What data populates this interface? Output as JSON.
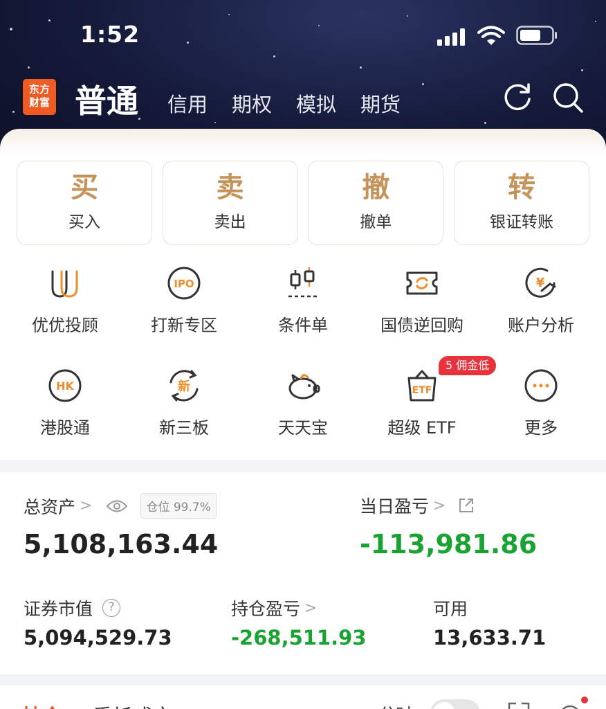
{
  "status": {
    "time": "1:52"
  },
  "header": {
    "logo_line1": "东方",
    "logo_line2": "财富",
    "active_mode": "普通",
    "modes": [
      "信用",
      "期权",
      "模拟",
      "期货"
    ]
  },
  "quick_actions": [
    {
      "big": "买",
      "label": "买入"
    },
    {
      "big": "卖",
      "label": "卖出"
    },
    {
      "big": "撤",
      "label": "撤单"
    },
    {
      "big": "转",
      "label": "银证转账"
    }
  ],
  "grid": [
    {
      "icon": "uu-icon",
      "label": "优优投顾"
    },
    {
      "icon": "ipo-icon",
      "icon_text": "IPO",
      "label": "打新专区"
    },
    {
      "icon": "candlestick-icon",
      "label": "条件单"
    },
    {
      "icon": "ticket-icon",
      "label": "国债逆回购"
    },
    {
      "icon": "yuan-chart-icon",
      "icon_text": "¥",
      "label": "账户分析"
    },
    {
      "icon": "hk-icon",
      "icon_text": "HK",
      "label": "港股通"
    },
    {
      "icon": "xin-icon",
      "icon_text": "新",
      "label": "新三板"
    },
    {
      "icon": "piggy-bank-icon",
      "label": "天天宝"
    },
    {
      "icon": "etf-icon",
      "icon_text": "ETF",
      "label": "超级 ETF",
      "badge": "5 佣金低"
    },
    {
      "icon": "more-icon",
      "label": "更多"
    }
  ],
  "assets": {
    "total_label": "总资产",
    "position_ratio": "仓位 99.7%",
    "total_value": "5,108,163.44",
    "daily_pl_label": "当日盈亏",
    "daily_pl_value": "-113,981.86",
    "market_value_label": "证券市值",
    "market_value": "5,094,529.73",
    "holding_pl_label": "持仓盈亏",
    "holding_pl_value": "-268,511.93",
    "available_label": "可用",
    "available_value": "13,633.71"
  },
  "bottom_tabs": {
    "active": "持仓",
    "other": "委托成交",
    "fenshi_label": "分时"
  },
  "colors": {
    "accent_gold": "#c5935a",
    "accent_orange": "#e5532a",
    "loss_green": "#1aa332",
    "badge_red": "#e8323c",
    "header_navy": "#151a3a"
  }
}
